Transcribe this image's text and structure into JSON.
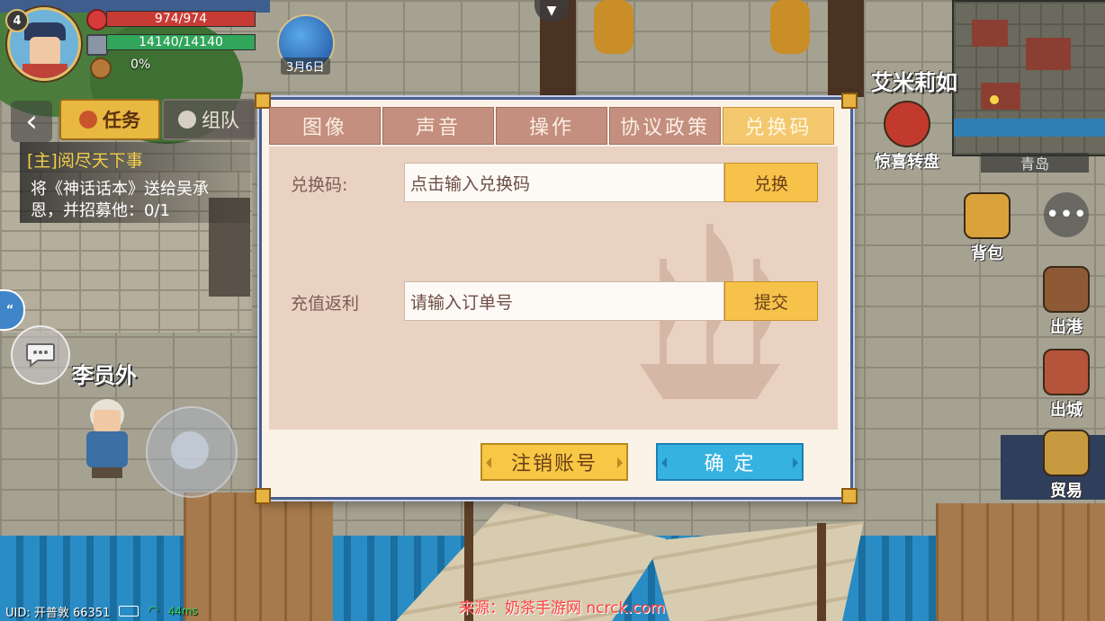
{
  "player": {
    "level": "4",
    "hp": "974/974",
    "mp": "14140/14140",
    "exp": "0%",
    "date": "3月6日"
  },
  "quest": {
    "back_icon": "‹",
    "task_label": "任务",
    "team_label": "组队",
    "title": "[主]阅尽天下事",
    "desc": "将《神话话本》送给吴承恩，并招募他：0/1"
  },
  "npcs": {
    "left_name": "李员外",
    "right_name": "艾米莉如"
  },
  "minimap": {
    "location": "青岛"
  },
  "right_menu": {
    "wheel": "惊喜转盘",
    "bag": "背包",
    "more": "•••",
    "port": "出港",
    "exit_city": "出城",
    "trade": "贸易"
  },
  "dialog": {
    "tabs": [
      "图像",
      "声音",
      "操作",
      "协议政策",
      "兑换码"
    ],
    "active_tab": 4,
    "redeem_label": "兑换码:",
    "redeem_placeholder": "点击输入兑换码",
    "redeem_button": "兑换",
    "rebate_label": "充值返利",
    "rebate_placeholder": "请输入订单号",
    "rebate_button": "提交",
    "logout_button": "注销账号",
    "ok_button": "确 定"
  },
  "status_bar": {
    "uid": "UID: 开普敦 66351",
    "ping": "44ms"
  },
  "watermark": "来源：奶茶手游网 ncrck.com",
  "colors": {
    "tab_inactive": "#c48f7e",
    "tab_active": "#f3c86d",
    "confirm_blue": "#35b2e0",
    "accent_yellow": "#f7c245",
    "hp_red": "#c63b34",
    "mp_green": "#31a55a"
  },
  "icons": {
    "hp": "heart-icon",
    "mp": "hammer-icon",
    "exp": "star-icon",
    "task": "leaf-icon",
    "team": "globe-icon",
    "chat": "chat-bubble-icon",
    "more": "ellipsis-icon",
    "bag": "backpack-icon",
    "back": "chevron-left-icon",
    "expand": "chevron-down-icon"
  }
}
